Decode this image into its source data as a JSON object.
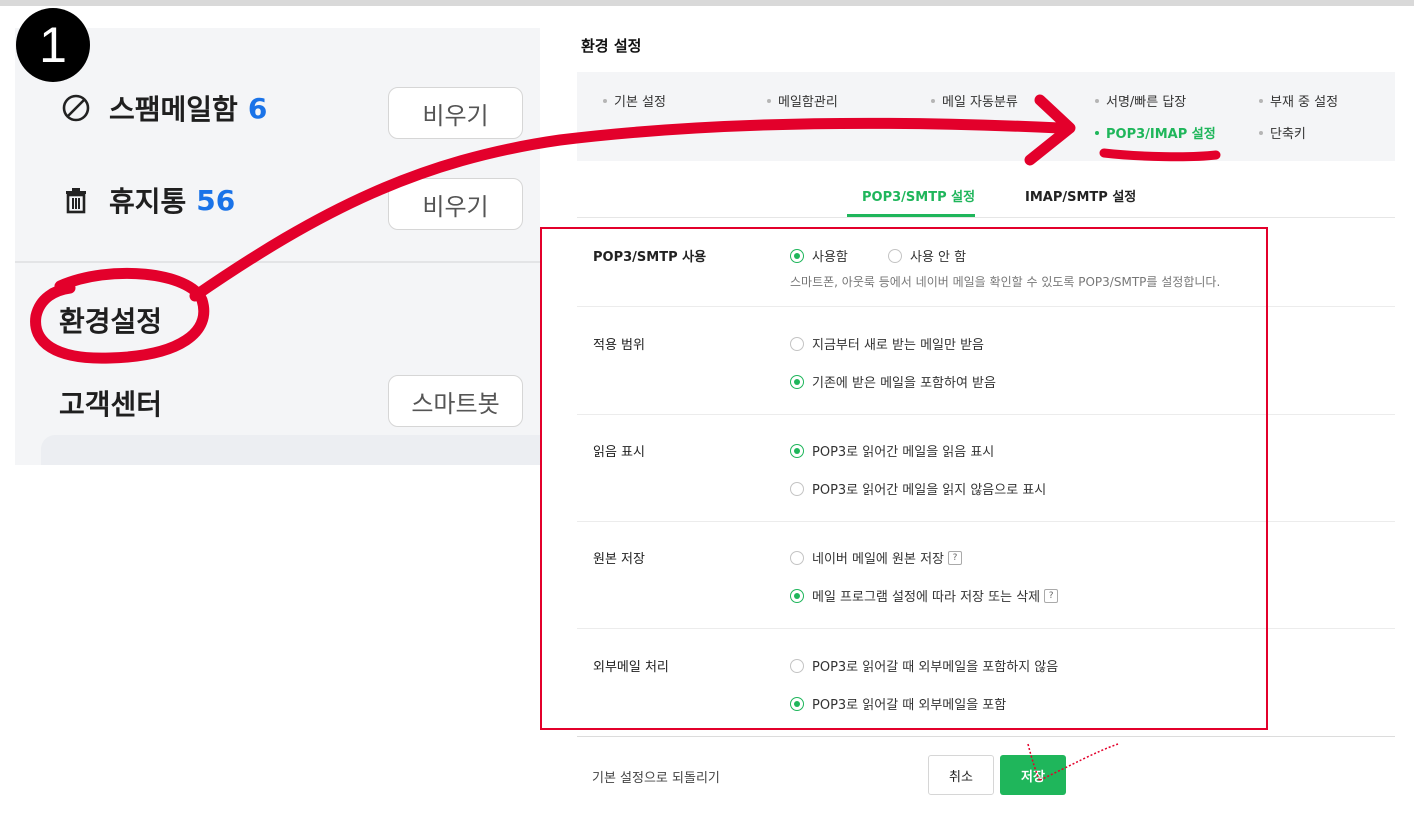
{
  "step_number": "1",
  "left": {
    "spam": {
      "label": "스팸메일함",
      "count": "6",
      "button": "비우기",
      "icon": "block-icon"
    },
    "trash": {
      "label": "휴지통",
      "count": "56",
      "button": "비우기",
      "icon": "trash-icon"
    },
    "settings_label": "환경설정",
    "support": {
      "label": "고객센터",
      "button": "스마트봇"
    }
  },
  "settings": {
    "title": "환경 설정",
    "menu": [
      {
        "label": "기본 설정"
      },
      {
        "label": "메일함관리"
      },
      {
        "label": "메일 자동분류"
      },
      {
        "label": "서명/빠른 답장"
      },
      {
        "label": "부재 중 설정"
      },
      {
        "label": "POP3/IMAP 설정",
        "active": true
      },
      {
        "label": "단축키"
      }
    ],
    "tabs": [
      {
        "label": "POP3/SMTP 설정",
        "active": true
      },
      {
        "label": "IMAP/SMTP 설정"
      }
    ],
    "rows": [
      {
        "label": "POP3/SMTP 사용",
        "options": [
          {
            "label": "사용함",
            "checked": true
          },
          {
            "label": "사용 안 함",
            "checked": false
          }
        ],
        "description": "스마트폰, 아웃룩 등에서 네이버 메일을 확인할 수 있도록 POP3/SMTP를 설정합니다."
      },
      {
        "label": "적용 범위",
        "options": [
          {
            "label": "지금부터 새로 받는 메일만 받음",
            "checked": false
          },
          {
            "label": "기존에 받은 메일을 포함하여 받음",
            "checked": true
          }
        ]
      },
      {
        "label": "읽음 표시",
        "options": [
          {
            "label": "POP3로 읽어간 메일을 읽음 표시",
            "checked": true
          },
          {
            "label": "POP3로 읽어간 메일을 읽지 않음으로 표시",
            "checked": false
          }
        ]
      },
      {
        "label": "원본 저장",
        "options": [
          {
            "label": "네이버 메일에 원본 저장",
            "checked": false,
            "help": "?"
          },
          {
            "label": "메일 프로그램 설정에 따라 저장 또는 삭제",
            "checked": true,
            "help": "?"
          }
        ]
      },
      {
        "label": "외부메일 처리",
        "options": [
          {
            "label": "POP3로 읽어갈 때 외부메일을 포함하지 않음",
            "checked": false
          },
          {
            "label": "POP3로 읽어갈 때 외부메일을 포함",
            "checked": true
          }
        ]
      }
    ],
    "footer": {
      "reset": "기본 설정으로 되돌리기",
      "cancel": "취소",
      "save": "저장"
    }
  },
  "colors": {
    "accent_green": "#1fb65b",
    "annotation_red": "#e3002b",
    "count_blue": "#1a73e8"
  }
}
